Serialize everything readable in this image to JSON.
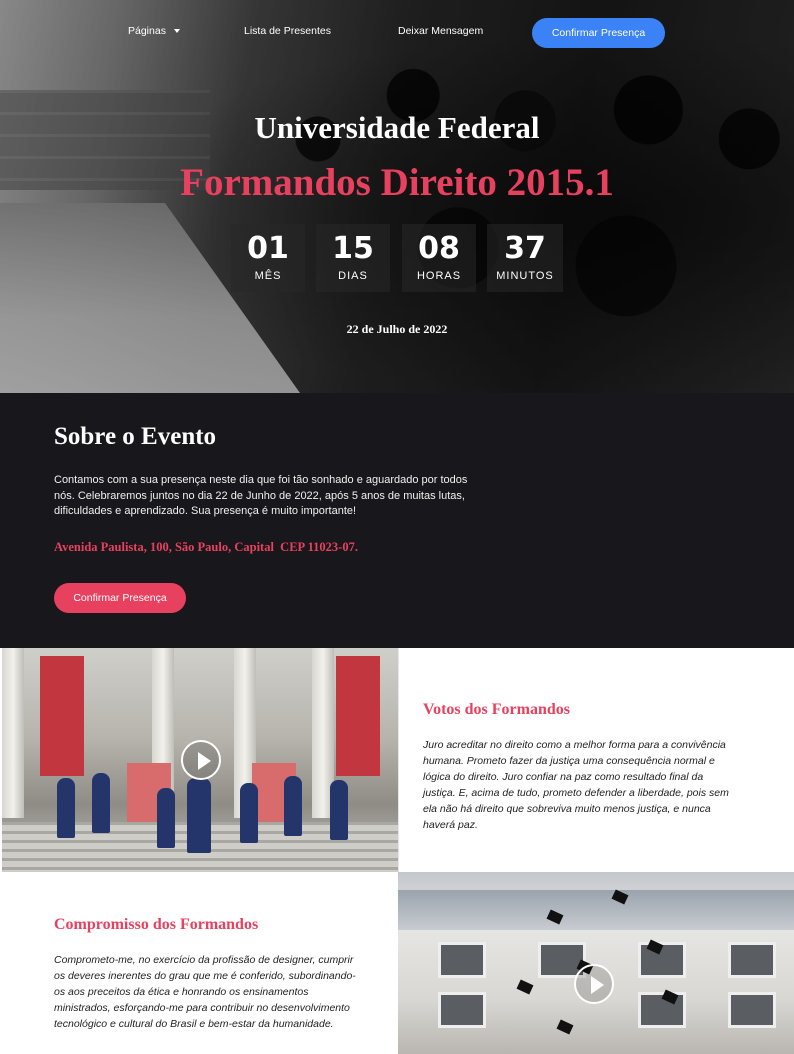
{
  "nav": {
    "pages_label": "Páginas",
    "gifts_label": "Lista de Presentes",
    "message_label": "Deixar Mensagem",
    "cta_label": "Confirmar Presença"
  },
  "hero": {
    "title": "Universidade Federal",
    "subtitle": "Formandos Direito 2015.1",
    "countdown": [
      {
        "value": "01",
        "label": "MÊS"
      },
      {
        "value": "15",
        "label": "DIAS"
      },
      {
        "value": "08",
        "label": "HORAS"
      },
      {
        "value": "37",
        "label": "MINUTOS"
      }
    ],
    "date": "22 de Julho de 2022"
  },
  "about": {
    "title": "Sobre o Evento",
    "text": "Contamos com a sua presença neste dia que foi tão sonhado e aguardado por todos nós. Celebraremos juntos no dia 22 de Junho de 2022, após 5 anos de muitas lutas, dificuldades e aprendizado. Sua presença é muito importante!",
    "address": "Avenida Paulista, 100, São Paulo, Capital  CEP 11023-07.",
    "cta_label": "Confirmar Presença"
  },
  "votos": {
    "title": "Votos dos Formandos",
    "text": "Juro acreditar no direito como a melhor forma para a convivência humana. Prometo fazer da justiça uma consequência normal e lógica do direito. Juro confiar na paz como resultado final da justiça. E, acima de tudo, prometo defender a liberdade, pois sem ela não há direito que sobreviva muito menos justiça, e nunca haverá paz."
  },
  "compromisso": {
    "title": "Compromisso dos Formandos",
    "text": "Comprometo-me, no exercício da profissão de designer, cumprir os deveres inerentes do grau que me é conferido, subordinando-os aos preceitos da ética e honrando os ensinamentos ministrados, esforçando-me para contribuir no desenvolvimento tecnológico e cultural do Brasil e bem-estar da humanidade."
  },
  "colors": {
    "accent": "#e8415f",
    "nav_cta": "#3b82f6",
    "about_bg": "#18171b"
  }
}
